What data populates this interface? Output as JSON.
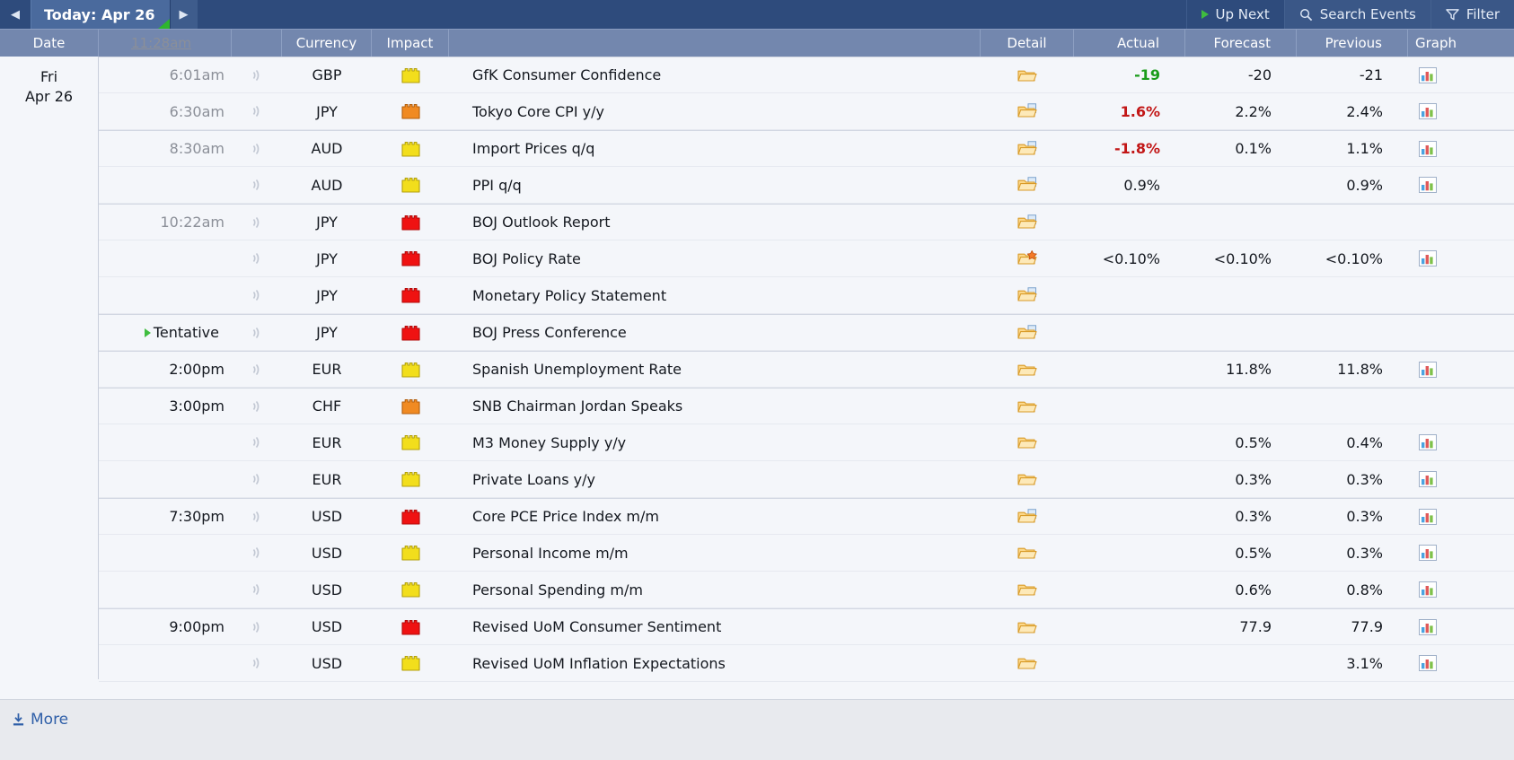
{
  "topbar": {
    "prev_arrow": "◀",
    "next_arrow": "▶",
    "today_label": "Today: Apr 26",
    "up_next_label": "Up Next",
    "search_label": "Search Events",
    "filter_label": "Filter"
  },
  "columns": {
    "date": "Date",
    "time": "11:28am",
    "currency": "Currency",
    "impact": "Impact",
    "detail": "Detail",
    "actual": "Actual",
    "forecast": "Forecast",
    "previous": "Previous",
    "graph": "Graph"
  },
  "date_group": {
    "weekday": "Fri",
    "daymonth": "Apr 26"
  },
  "footer": {
    "more_label": "More"
  },
  "colors": {
    "accent": "#2e4b7c",
    "header_row": "#7387ae",
    "impact_low": "#f2de1c",
    "impact_medium": "#f08a22",
    "impact_high": "#ef1212",
    "value_better": "#1a9c1a",
    "value_worse": "#c21616",
    "link": "#2f5fa8"
  },
  "rows": [
    {
      "time": "6:01am",
      "time_style": "muted",
      "currency": "GBP",
      "impact": "low",
      "event": "GfK Consumer Confidence",
      "detail_icon": "folder-icon",
      "actual": "-19",
      "actual_state": "up",
      "forecast": "-20",
      "previous": "-21",
      "graph": true,
      "group_start": true
    },
    {
      "time": "6:30am",
      "time_style": "muted",
      "currency": "JPY",
      "impact": "medium",
      "event": "Tokyo Core CPI y/y",
      "detail_icon": "folder-document-icon",
      "actual": "1.6%",
      "actual_state": "down",
      "forecast": "2.2%",
      "previous": "2.4%",
      "graph": true,
      "group_start": false
    },
    {
      "time": "8:30am",
      "time_style": "muted",
      "currency": "AUD",
      "impact": "low",
      "event": "Import Prices q/q",
      "detail_icon": "folder-document-icon",
      "actual": "-1.8%",
      "actual_state": "down",
      "forecast": "0.1%",
      "previous": "1.1%",
      "graph": true,
      "group_start": true
    },
    {
      "time": "",
      "time_style": "muted",
      "currency": "AUD",
      "impact": "low",
      "event": "PPI q/q",
      "detail_icon": "folder-document-icon",
      "actual": "0.9%",
      "actual_state": "neutral",
      "forecast": "",
      "previous": "0.9%",
      "graph": true,
      "group_start": false
    },
    {
      "time": "10:22am",
      "time_style": "muted",
      "currency": "JPY",
      "impact": "high",
      "event": "BOJ Outlook Report",
      "detail_icon": "folder-document-icon",
      "actual": "",
      "actual_state": "neutral",
      "forecast": "",
      "previous": "",
      "graph": false,
      "group_start": true
    },
    {
      "time": "",
      "time_style": "muted",
      "currency": "JPY",
      "impact": "high",
      "event": "BOJ Policy Rate",
      "detail_icon": "folder-star-icon",
      "actual": "<0.10%",
      "actual_state": "neutral",
      "forecast": "<0.10%",
      "previous": "<0.10%",
      "graph": true,
      "group_start": false
    },
    {
      "time": "",
      "time_style": "muted",
      "currency": "JPY",
      "impact": "high",
      "event": "Monetary Policy Statement",
      "detail_icon": "folder-document-icon",
      "actual": "",
      "actual_state": "neutral",
      "forecast": "",
      "previous": "",
      "graph": false,
      "group_start": false
    },
    {
      "time": "Tentative",
      "time_style": "tentative",
      "currency": "JPY",
      "impact": "high",
      "event": "BOJ Press Conference",
      "detail_icon": "folder-document-icon",
      "actual": "",
      "actual_state": "neutral",
      "forecast": "",
      "previous": "",
      "graph": false,
      "group_start": true
    },
    {
      "time": "2:00pm",
      "time_style": "dark",
      "currency": "EUR",
      "impact": "low",
      "event": "Spanish Unemployment Rate",
      "detail_icon": "folder-icon",
      "actual": "",
      "actual_state": "neutral",
      "forecast": "11.8%",
      "previous": "11.8%",
      "graph": true,
      "group_start": true
    },
    {
      "time": "3:00pm",
      "time_style": "dark",
      "currency": "CHF",
      "impact": "medium",
      "event": "SNB Chairman Jordan Speaks",
      "detail_icon": "folder-icon",
      "actual": "",
      "actual_state": "neutral",
      "forecast": "",
      "previous": "",
      "graph": false,
      "group_start": true
    },
    {
      "time": "",
      "time_style": "dark",
      "currency": "EUR",
      "impact": "low",
      "event": "M3 Money Supply y/y",
      "detail_icon": "folder-icon",
      "actual": "",
      "actual_state": "neutral",
      "forecast": "0.5%",
      "previous": "0.4%",
      "graph": true,
      "group_start": false
    },
    {
      "time": "",
      "time_style": "dark",
      "currency": "EUR",
      "impact": "low",
      "event": "Private Loans y/y",
      "detail_icon": "folder-icon",
      "actual": "",
      "actual_state": "neutral",
      "forecast": "0.3%",
      "previous": "0.3%",
      "graph": true,
      "group_start": false
    },
    {
      "time": "7:30pm",
      "time_style": "dark",
      "currency": "USD",
      "impact": "high",
      "event": "Core PCE Price Index m/m",
      "detail_icon": "folder-document-icon",
      "actual": "",
      "actual_state": "neutral",
      "forecast": "0.3%",
      "previous": "0.3%",
      "graph": true,
      "group_start": true
    },
    {
      "time": "",
      "time_style": "dark",
      "currency": "USD",
      "impact": "low",
      "event": "Personal Income m/m",
      "detail_icon": "folder-icon",
      "actual": "",
      "actual_state": "neutral",
      "forecast": "0.5%",
      "previous": "0.3%",
      "graph": true,
      "group_start": false
    },
    {
      "time": "",
      "time_style": "dark",
      "currency": "USD",
      "impact": "low",
      "event": "Personal Spending m/m",
      "detail_icon": "folder-icon",
      "actual": "",
      "actual_state": "neutral",
      "forecast": "0.6%",
      "previous": "0.8%",
      "graph": true,
      "group_start": false
    },
    {
      "time": "9:00pm",
      "time_style": "dark",
      "currency": "USD",
      "impact": "high",
      "event": "Revised UoM Consumer Sentiment",
      "detail_icon": "folder-icon",
      "actual": "",
      "actual_state": "neutral",
      "forecast": "77.9",
      "previous": "77.9",
      "graph": true,
      "group_start": true
    },
    {
      "time": "",
      "time_style": "dark",
      "currency": "USD",
      "impact": "low",
      "event": "Revised UoM Inflation Expectations",
      "detail_icon": "folder-icon",
      "actual": "",
      "actual_state": "neutral",
      "forecast": "",
      "previous": "3.1%",
      "graph": true,
      "group_start": false
    }
  ]
}
